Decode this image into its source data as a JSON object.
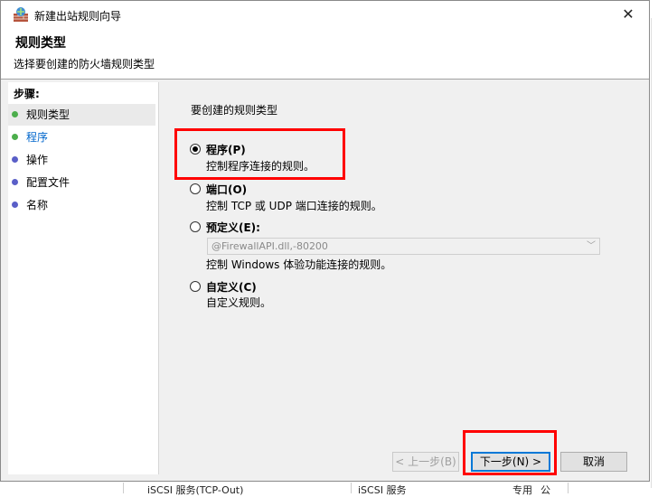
{
  "window": {
    "title": "新建出站规则向导",
    "close": "✕"
  },
  "header": {
    "title": "规则类型",
    "subtitle": "选择要创建的防火墙规则类型"
  },
  "steps": {
    "title": "步骤:",
    "items": [
      {
        "label": "规则类型",
        "color": "#4cae4c"
      },
      {
        "label": "程序",
        "color": "#4cae4c"
      },
      {
        "label": "操作",
        "color": "#5a5fc8"
      },
      {
        "label": "配置文件",
        "color": "#5a5fc8"
      },
      {
        "label": "名称",
        "color": "#5a5fc8"
      }
    ]
  },
  "content": {
    "prompt": "要创建的规则类型",
    "options": [
      {
        "label": "程序(P)",
        "desc": "控制程序连接的规则。",
        "selected": true
      },
      {
        "label": "端口(O)",
        "desc": "控制 TCP 或 UDP 端口连接的规则。",
        "selected": false
      },
      {
        "label": "预定义(E):",
        "desc": "控制 Windows 体验功能连接的规则。",
        "selected": false
      },
      {
        "label": "自定义(C)",
        "desc": "自定义规则。",
        "selected": false
      }
    ],
    "predefined_value": "@FirewallAPI.dll,-80200"
  },
  "buttons": {
    "back": "< 上一步(B)",
    "next": "下一步(N) >",
    "cancel": "取消"
  },
  "background": {
    "row_name": "iSCSI 服务(TCP-Out)",
    "row_group": "iSCSI 服务",
    "row_profile": "专用",
    "row_extra": "公"
  },
  "colors": {
    "highlight": "#ff0000",
    "link_blue": "#0066cc"
  }
}
